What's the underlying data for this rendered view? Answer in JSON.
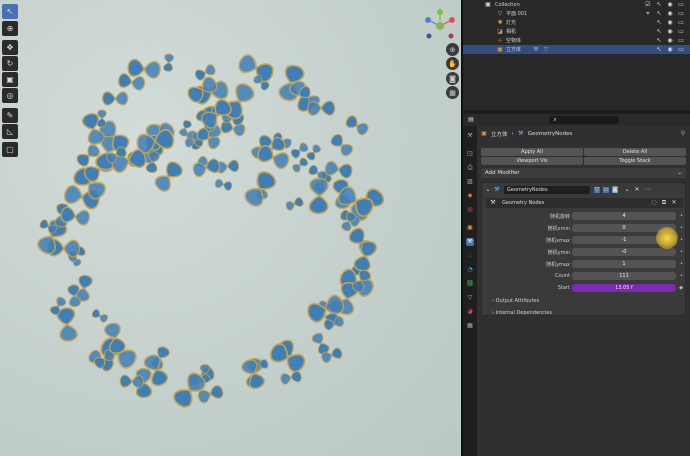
{
  "outliner": {
    "rows": [
      {
        "name": "Collection"
      },
      {
        "name": "平面.001"
      },
      {
        "name": "灯光"
      },
      {
        "name": "相机"
      },
      {
        "name": "空物体"
      },
      {
        "name": "立方体"
      }
    ]
  },
  "properties": {
    "breadcrumb": {
      "object": "立方体",
      "modifier": "GeometryNodes"
    },
    "buttons": {
      "apply_all": "Apply All",
      "delete_all": "Delete All",
      "viewport_vis": "Viewport Vis",
      "toggle_stack": "Toggle Stack"
    },
    "add_modifier": "Add Modifier",
    "modifier": {
      "name": "GeometryNodes",
      "node_group": "Geometry Nodes",
      "inputs": [
        {
          "label": "随机旋转",
          "value": "4"
        },
        {
          "label": "随机xmin",
          "value": "0"
        },
        {
          "label": "随机xmax",
          "value": "-1"
        },
        {
          "label": "随机ymin",
          "value": "-0"
        },
        {
          "label": "随机ymax",
          "value": "1"
        },
        {
          "label": "Count",
          "value": "111"
        },
        {
          "label": "Start",
          "value": "13.05 f"
        }
      ],
      "sections": [
        "Output Attributes",
        "Internal Dependencies"
      ]
    }
  },
  "colors": {
    "selection": "#334d80",
    "accent_blue": "#4772b3",
    "start_field": "#7a2bb0",
    "viewport_bg": "#c9d4d0",
    "butterfly_blue": "#3f7fb8",
    "butterfly_gold": "#c9a24a"
  },
  "icons": [
    "select-tool-icon",
    "cursor-tool-icon",
    "move-tool-icon",
    "rotate-tool-icon",
    "scale-tool-icon",
    "transform-tool-icon",
    "annotate-tool-icon",
    "measure-tool-icon",
    "add-cube-tool-icon",
    "zoom-icon",
    "hand-icon",
    "camera-icon",
    "grid-icon"
  ]
}
